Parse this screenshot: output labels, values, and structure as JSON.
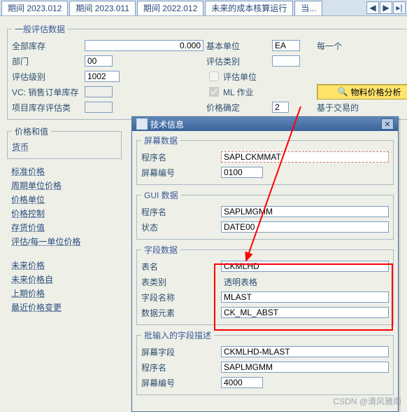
{
  "tabs": {
    "t1": "期间 2023.012",
    "t2": "期间 2023.011",
    "t3": "期间 2022.012",
    "t4": "未来的成本核算运行",
    "t5": "当..."
  },
  "section1": {
    "legend": "一般评估数据",
    "total_stock_lbl": "全部库存",
    "total_stock_val": "0.000",
    "base_unit_lbl": "基本单位",
    "base_unit_val": "EA",
    "base_unit_desc": "每一个",
    "dept_lbl": "部门",
    "dept_val": "00",
    "val_cat_lbl": "评估类别",
    "val_class_lbl": "评估级别",
    "val_class_val": "1002",
    "val_unit_chk_lbl": "评估单位",
    "vc_lbl": "VC: 销售订单库存",
    "ml_chk_lbl": "ML 作业",
    "price_analysis_btn": "物料价格分析",
    "proj_lbl": "项目库存评估类",
    "price_det_lbl": "价格确定",
    "price_det_val": "2",
    "price_det_desc": "基于交易的"
  },
  "side": {
    "grp1": "价格和值",
    "currency": "货币",
    "std_price": "标准价格",
    "period_unit": "周期单位价格",
    "price_unit": "价格单位",
    "price_ctrl": "价格控制",
    "inv_val": "存货价值",
    "per_unit": "评估/每一单位价格",
    "future": "未来价格",
    "future_from": "未来价格自",
    "prev_price": "上期价格",
    "last_change": "最近价格变更"
  },
  "modal": {
    "title": "技术信息",
    "g1_legend": "屏幕数据",
    "g1_prog_lbl": "程序名",
    "g1_prog_val": "SAPLCKMMAT",
    "g1_scr_lbl": "屏幕编号",
    "g1_scr_val": "0100",
    "g2_legend": "GUI 数据",
    "g2_prog_lbl": "程序名",
    "g2_prog_val": "SAPLMGMM",
    "g2_stat_lbl": "状态",
    "g2_stat_val": "DATE00",
    "g3_legend": "字段数据",
    "g3_tab_lbl": "表名",
    "g3_tab_val": "CKMLHD",
    "g3_tcat_lbl": "表类别",
    "g3_tcat_val": "透明表格",
    "g3_fname_lbl": "字段名称",
    "g3_fname_val": "MLAST",
    "g3_de_lbl": "数据元素",
    "g3_de_val": "CK_ML_ABST",
    "g4_legend": "批输入的字段描述",
    "g4_sf_lbl": "屏幕字段",
    "g4_sf_val": "CKMLHD-MLAST",
    "g4_prog_lbl": "程序名",
    "g4_prog_val": "SAPLMGMM",
    "g4_scr_lbl": "屏幕编号",
    "g4_scr_val": "4000"
  },
  "icons": {
    "search": "🔍",
    "close": "✕",
    "doc": "▦",
    "left": "◀",
    "right": "▶",
    "end": "▸|"
  },
  "watermark": "CSDN @清风雅雨"
}
